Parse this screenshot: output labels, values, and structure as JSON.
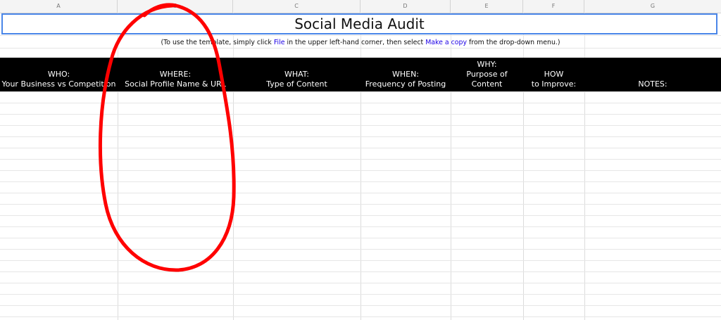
{
  "columns": [
    "A",
    "B",
    "C",
    "D",
    "E",
    "F",
    "G"
  ],
  "title": "Social Media Audit",
  "instructions": {
    "prefix": "(To use the template, simply click ",
    "file_link": "File",
    "middle": " in the upper left-hand corner, then select ",
    "copy_link": "Make a copy",
    "suffix": " from the drop-down menu.)"
  },
  "headers": {
    "who_1": "WHO:",
    "who_2": "Your Business vs Competition",
    "where_1": "WHERE:",
    "where_2": "Social Profile Name & URL",
    "what_1": "WHAT:",
    "what_2": "Type of Content",
    "when_1": "WHEN:",
    "when_2": "Frequency of Posting",
    "why_1": "WHY:",
    "why_2": "Purpose of",
    "why_3": "Content",
    "how_1": "HOW",
    "how_2": "to Improve:",
    "notes": "NOTES:"
  },
  "colors": {
    "header_bg": "#000000",
    "header_text": "#ffffff",
    "selection_border": "#4a86e8",
    "link": "#1c00e6",
    "annotation": "#ff0000"
  },
  "annotation": "red-hand-drawn-circle-around-column-B"
}
